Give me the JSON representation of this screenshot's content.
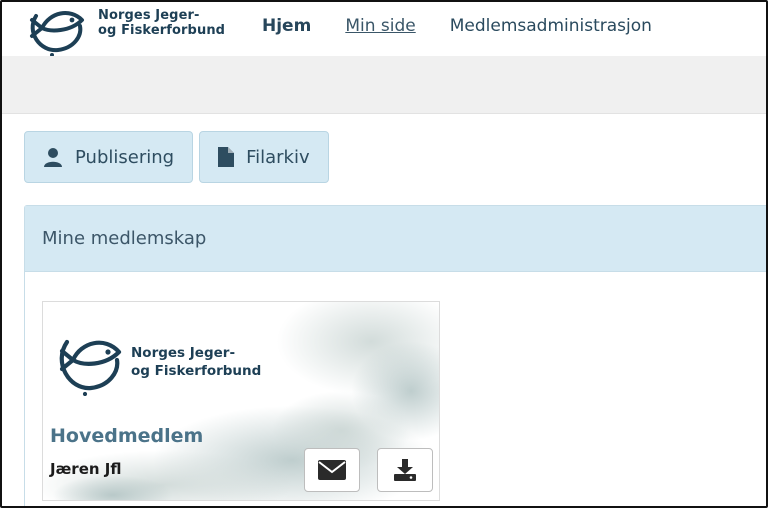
{
  "header": {
    "logo_line1": "Norges Jeger-",
    "logo_line2": "og Fiskerforbund",
    "nav": [
      {
        "label": "Hjem"
      },
      {
        "label": "Min side"
      },
      {
        "label": "Medlemsadministrasjon"
      }
    ]
  },
  "tabs": [
    {
      "label": "Publisering",
      "icon": "user-icon"
    },
    {
      "label": "Filarkiv",
      "icon": "file-icon"
    }
  ],
  "panel": {
    "title": "Mine medlemskap"
  },
  "card": {
    "logo_line1": "Norges Jeger-",
    "logo_line2": "og Fiskerforbund",
    "membership_type": "Hovedmedlem",
    "club": "Jæren Jfl",
    "actions": [
      {
        "icon": "envelope-icon"
      },
      {
        "icon": "download-icon"
      }
    ]
  },
  "colors": {
    "brand_dark": "#1d3f55",
    "tab_bg": "#d5e9f3",
    "header_grey": "#f0f0f0",
    "membership_type": "#4b7389"
  }
}
